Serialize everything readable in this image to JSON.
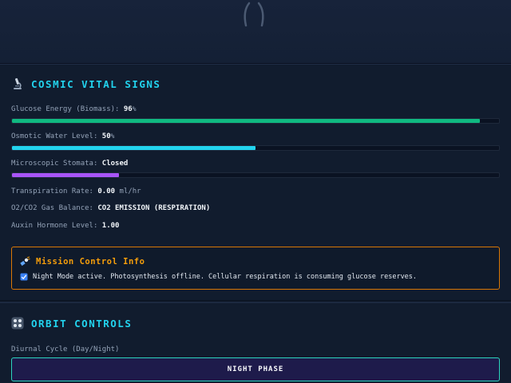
{
  "vitals": {
    "title": "COSMIC VITAL SIGNS",
    "glucose": {
      "label": "Glucose Energy (Biomass):",
      "value": "96",
      "unit": "%",
      "level": 0.96
    },
    "water": {
      "label": "Osmotic Water Level:",
      "value": "50",
      "unit": "%",
      "level": 0.5
    },
    "stomata": {
      "label": "Microscopic Stomata:",
      "value": "Closed",
      "level": 0.22
    },
    "transpiration": {
      "label": "Transpiration Rate:",
      "value": "0.00",
      "unit": "ml/hr"
    },
    "gas": {
      "label": "O2/CO2 Gas Balance:",
      "value": "CO2 EMISSION (RESPIRATION)"
    },
    "auxin": {
      "label": "Auxin Hormone Level:",
      "value": "1.00"
    }
  },
  "info": {
    "title": "Mission Control Info",
    "message": "Night Mode active. Photosynthesis offline. Cellular respiration is consuming glucose reserves."
  },
  "controls": {
    "title": "ORBIT CONTROLS",
    "cycle_label": "Diurnal Cycle (Day/Night)",
    "cycle_button": "NIGHT PHASE"
  },
  "colors": {
    "accent": "#22d3ee",
    "glucose_bar": "#10b981",
    "water_bar": "#22d3ee",
    "stomata_bar": "#a855f7",
    "warning": "#f59e0b"
  },
  "icons": {
    "vitals": "microscope-icon",
    "info": "satellite-icon",
    "info_item": "check-box-icon",
    "controls": "control-pad-icon"
  }
}
